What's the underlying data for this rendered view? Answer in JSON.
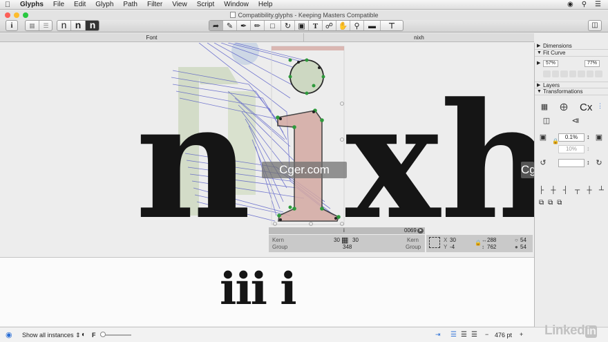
{
  "menubar": {
    "app": "Glyphs",
    "items": [
      "File",
      "Edit",
      "Glyph",
      "Path",
      "Filter",
      "View",
      "Script",
      "Window",
      "Help"
    ]
  },
  "window": {
    "title": "Compatibility.glyphs - Keeping Masters Compatible"
  },
  "toolbar": {
    "info_label": "i",
    "view_buttons": [
      "n",
      "n",
      "n"
    ]
  },
  "tabs": {
    "left": "Font",
    "right": "nixh"
  },
  "canvas": {
    "text": "nixh",
    "glyph_i_letter": "i"
  },
  "infobar": {
    "glyph_name": "i",
    "unicode": "0069",
    "kern_label": "Kern",
    "group_label": "Group",
    "lsb": "30",
    "rsb": "30",
    "width": "348",
    "x_label": "X",
    "x_value": "30",
    "y_label": "Y",
    "y_value": "-4",
    "w_value": "288",
    "h_value": "762",
    "nodes_a": "54",
    "nodes_b": "54"
  },
  "preview": {
    "text": "iii i"
  },
  "statusbar": {
    "instances_label": "Show all instances",
    "f_label": "F",
    "font_size": "476 pt",
    "minus": "−",
    "plus": "+"
  },
  "panel": {
    "dimensions": "Dimensions",
    "fit_curve": "Fit Curve",
    "fit_min": "57%",
    "fit_max": "77%",
    "layers": "Layers",
    "transformations": "Transformations",
    "scale_value": "0.1%",
    "scale_value2": "10%",
    "cx_label": "Cx"
  },
  "watermarks": [
    "Cger.com",
    "Cger.com"
  ],
  "brand": "Linked",
  "brand_in": "in",
  "colors": {
    "accent": "#2b6fd6",
    "outline_fill": "#d4a9a3",
    "interpolation_lines": "#4a50c4",
    "nodes": "#2e9a3c",
    "background_glyph": "#cfdac2"
  }
}
